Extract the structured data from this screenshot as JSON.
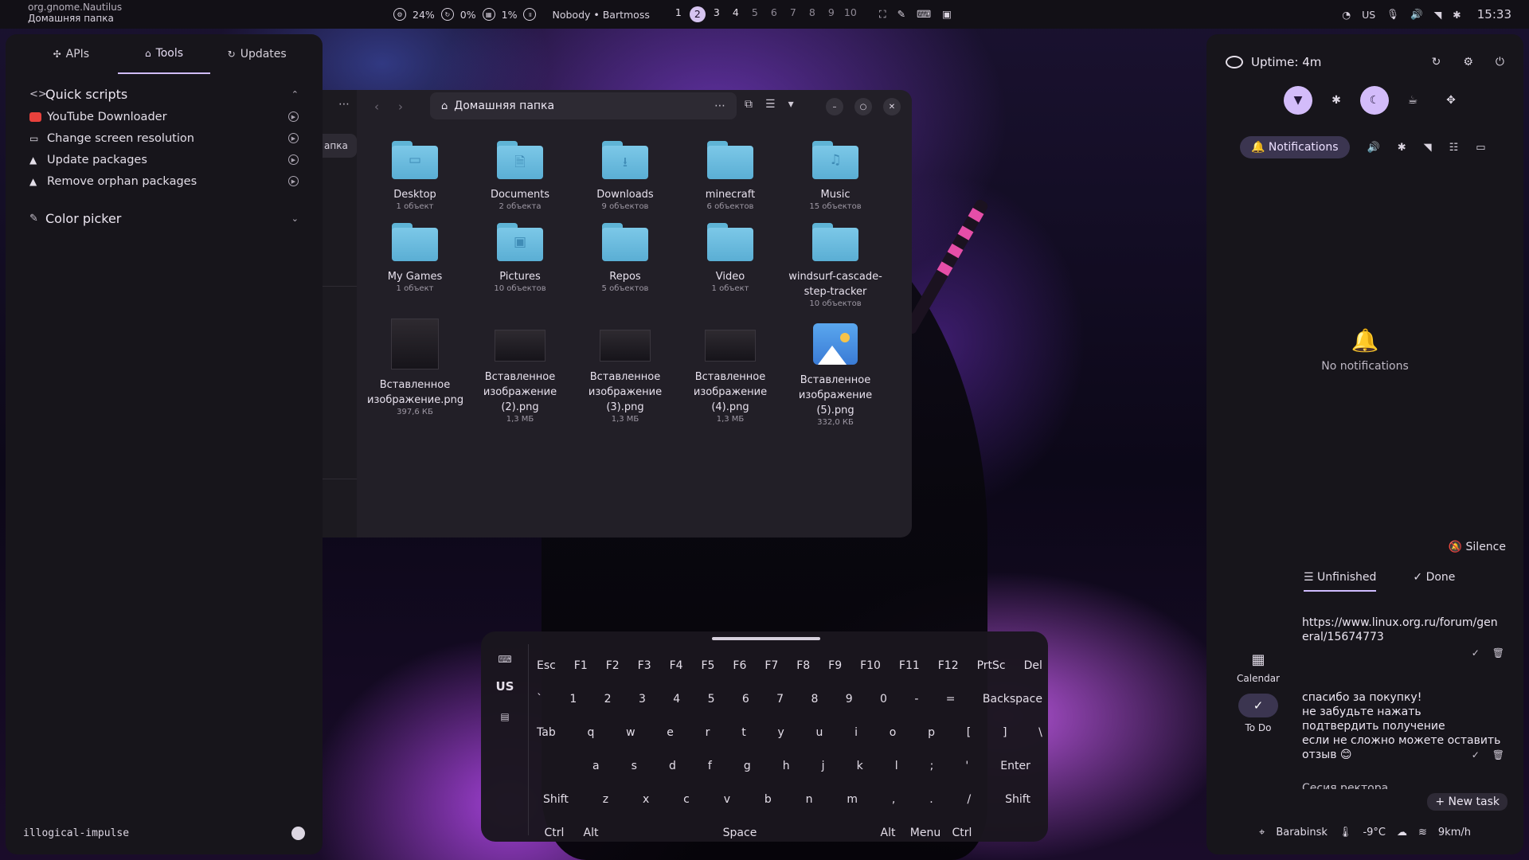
{
  "topbar": {
    "app_id": "org.gnome.Nautilus",
    "app_title": "Домашняя папка",
    "cpu": "24%",
    "swap": "0%",
    "ram": "1%",
    "media": "Nobody • Bartmoss",
    "workspaces": [
      "1",
      "2",
      "3",
      "4",
      "5",
      "6",
      "7",
      "8",
      "9",
      "10"
    ],
    "active_workspace": "2",
    "layout": "US",
    "clock": "15:33"
  },
  "left_panel": {
    "tabs": [
      {
        "icon": "apis-icon",
        "label": "APIs"
      },
      {
        "icon": "tools-icon",
        "label": "Tools"
      },
      {
        "icon": "updates-icon",
        "label": "Updates"
      }
    ],
    "quick_scripts_title": "Quick scripts",
    "scripts": [
      "YouTube Downloader",
      "Change screen resolution",
      "Update packages",
      "Remove orphan packages"
    ],
    "color_picker_title": "Color picker",
    "footer": "illogical-impulse"
  },
  "nautilus": {
    "sidebar_fragment": "апка",
    "path": "Домашняя папка",
    "items": [
      {
        "name": "Desktop",
        "meta": "1 объект",
        "kind": "folder",
        "emblem": "▭"
      },
      {
        "name": "Documents",
        "meta": "2 объекта",
        "kind": "folder",
        "emblem": "🗎"
      },
      {
        "name": "Downloads",
        "meta": "9 объектов",
        "kind": "folder",
        "emblem": "⭳"
      },
      {
        "name": "minecraft",
        "meta": "6 объектов",
        "kind": "folder",
        "emblem": ""
      },
      {
        "name": "Music",
        "meta": "15 объектов",
        "kind": "folder",
        "emblem": "♫"
      },
      {
        "name": "My Games",
        "meta": "1 объект",
        "kind": "folder",
        "emblem": ""
      },
      {
        "name": "Pictures",
        "meta": "10 объектов",
        "kind": "folder",
        "emblem": "▣"
      },
      {
        "name": "Repos",
        "meta": "5 объектов",
        "kind": "folder",
        "emblem": ""
      },
      {
        "name": "Video",
        "meta": "1 объект",
        "kind": "folder",
        "emblem": ""
      },
      {
        "name": "windsurf-cascade-step-tracker",
        "meta": "10 объектов",
        "kind": "folder",
        "emblem": ""
      },
      {
        "name": "Вставленное изображение.png",
        "meta": "397,6 КБ",
        "kind": "thumb-tall",
        "emblem": ""
      },
      {
        "name": "Вставленное изображение (2).png",
        "meta": "1,3 МБ",
        "kind": "thumb",
        "emblem": ""
      },
      {
        "name": "Вставленное изображение (3).png",
        "meta": "1,3 МБ",
        "kind": "thumb",
        "emblem": ""
      },
      {
        "name": "Вставленное изображение (4).png",
        "meta": "1,3 МБ",
        "kind": "thumb",
        "emblem": ""
      },
      {
        "name": "Вставленное изображение (5).png",
        "meta": "332,0 КБ",
        "kind": "image-icon",
        "emblem": ""
      }
    ]
  },
  "keyboard": {
    "layout": "US",
    "rows": [
      [
        "Esc",
        "F1",
        "F2",
        "F3",
        "F4",
        "F5",
        "F6",
        "F7",
        "F8",
        "F9",
        "F10",
        "F11",
        "F12",
        "PrtSc",
        "Del"
      ],
      [
        "`",
        "1",
        "2",
        "3",
        "4",
        "5",
        "6",
        "7",
        "8",
        "9",
        "0",
        "-",
        "=",
        "Backspace"
      ],
      [
        "Tab",
        "q",
        "w",
        "e",
        "r",
        "t",
        "y",
        "u",
        "i",
        "o",
        "p",
        "[",
        "]",
        "\\"
      ],
      [
        "a",
        "s",
        "d",
        "f",
        "g",
        "h",
        "j",
        "k",
        "l",
        ";",
        "'",
        "Enter"
      ],
      [
        "Shift",
        "z",
        "x",
        "c",
        "v",
        "b",
        "n",
        "m",
        ",",
        ".",
        "/",
        "Shift"
      ],
      [
        "Ctrl",
        "Alt",
        "Space",
        "Alt",
        "Menu",
        "Ctrl"
      ]
    ]
  },
  "right_panel": {
    "uptime": "Uptime: 4m",
    "notifications_tab": "Notifications",
    "no_notifications": "No notifications",
    "silence": "Silence",
    "tabs": {
      "unfinished": "Unfinished",
      "done": "Done"
    },
    "calendar_label": "Calendar",
    "todo_label": "To Do",
    "tasks": [
      "https://www.linux.org.ru/forum/general/15674773",
      "спасибо за покупку!\nне забудьте нажать подтвердить получение\nесли не сложно можете оставить отзыв 😊",
      "Сесия ректора"
    ],
    "new_task": "+ New task",
    "weather": {
      "city": "Barabinsk",
      "temp": "-9°C",
      "wind": "9km/h"
    }
  }
}
